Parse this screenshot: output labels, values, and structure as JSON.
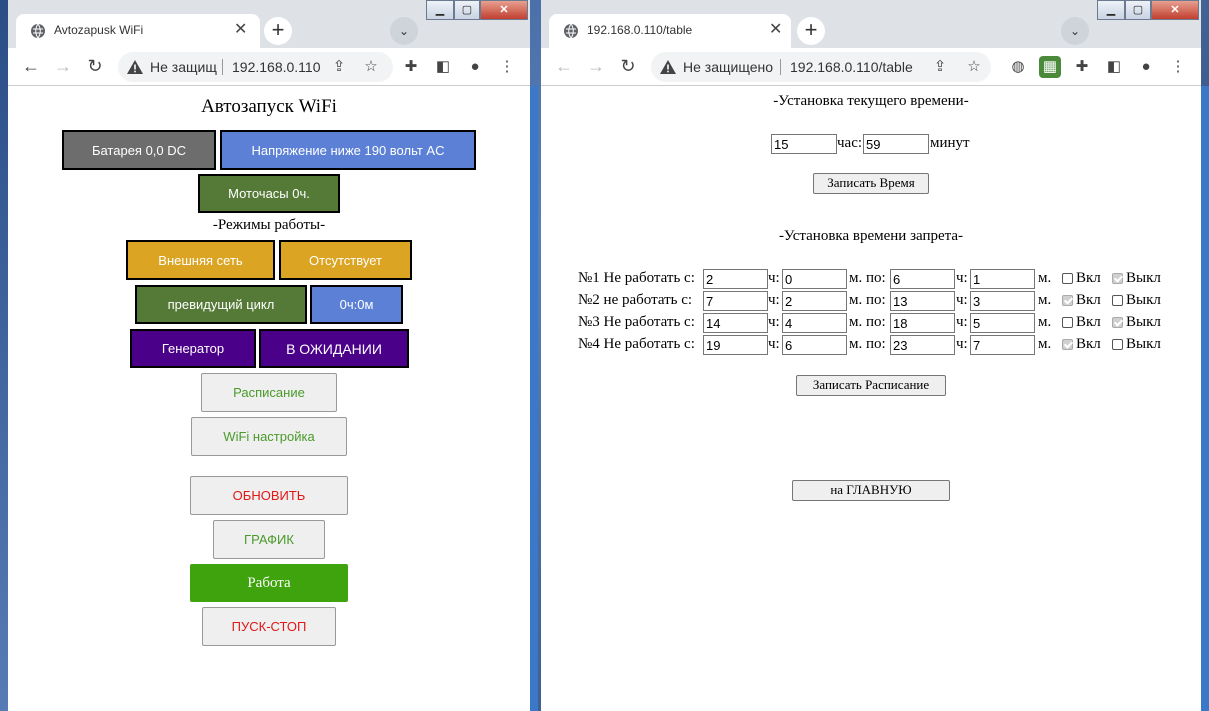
{
  "left_window": {
    "tab_title": "Avtozapusk WiFi",
    "omnibox": {
      "security": "Не защищ",
      "url": "192.168.0.110"
    },
    "page": {
      "title": "Автозапуск WiFi",
      "battery": "Батарея 0,0 DC",
      "voltage": "Напряжение ниже 190 вольт AC",
      "motohours": "Моточасы 0ч.",
      "modes_heading": "-Режимы работы-",
      "external_network": "Внешняя сеть",
      "absent": "Отсутствует",
      "previous_cycle": "превидущий цикл",
      "cycle_time": "0ч:0м",
      "generator": "Генератор",
      "waiting": "В ОЖИДАНИИ",
      "schedule_button": "Расписание",
      "wifi_button": "WiFi настройка",
      "refresh_button": "ОБНОВИТЬ",
      "chart_button": "ГРАФИК",
      "work_button": "Работа",
      "start_stop_button": "ПУСК-СТОП"
    }
  },
  "right_window": {
    "tab_title": "192.168.0.110/table",
    "omnibox": {
      "security": "Не защищено",
      "url": "192.168.0.110/table"
    },
    "page": {
      "time_heading": "-Установка текущего времени-",
      "hour_value": "15",
      "hour_label": "час:",
      "minute_value": "59",
      "minute_label": "минут",
      "write_time_button": "Записать Время",
      "ban_heading": "-Установка времени запрета-",
      "rows": [
        {
          "label": "№1 Не работать с:",
          "from_h": "2",
          "from_m": "0",
          "to_h": "6",
          "to_m": "1",
          "on": false,
          "off": true
        },
        {
          "label": "№2 не работать с:",
          "from_h": "7",
          "from_m": "2",
          "to_h": "13",
          "to_m": "3",
          "on": true,
          "off": false
        },
        {
          "label": "№3 Не работать с:",
          "from_h": "14",
          "from_m": "4",
          "to_h": "18",
          "to_m": "5",
          "on": false,
          "off": true
        },
        {
          "label": "№4 Не работать с:",
          "from_h": "19",
          "from_m": "6",
          "to_h": "23",
          "to_m": "7",
          "on": true,
          "off": false
        }
      ],
      "h_label": "ч:",
      "m_to_label": "м. по:",
      "m_label": "м.",
      "on_label": "Вкл",
      "off_label": "Выкл",
      "write_schedule_button": "Записать Расписание",
      "main_button": "на ГЛАВНУЮ"
    }
  },
  "colors": {
    "gray_block": "#6d6d6d",
    "blue_block": "#5b80d6",
    "green_block": "#557a38",
    "amber_block": "#dba422",
    "purple_block": "#4b0089",
    "green_text": "#4a9a2a",
    "red_text": "#e01818",
    "work_green": "#3ea30c"
  }
}
